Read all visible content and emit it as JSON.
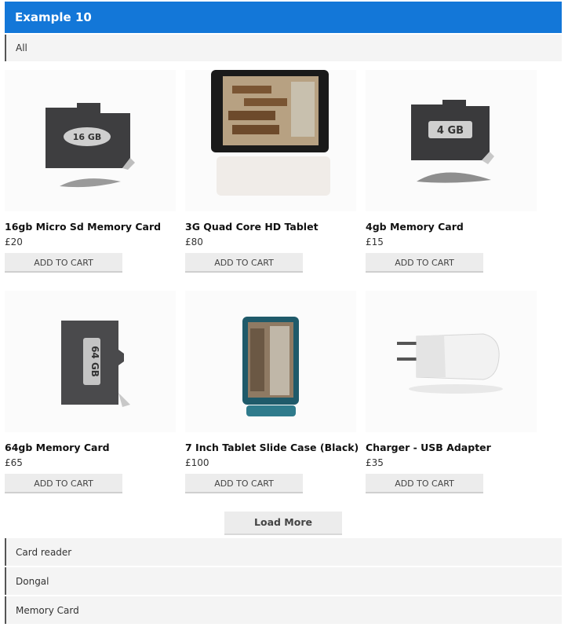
{
  "header": {
    "title": "Example 10"
  },
  "filter": {
    "label": "All"
  },
  "products": [
    {
      "name": "16gb Micro Sd Memory Card",
      "price": "£20",
      "button": "ADD TO CART",
      "card_text": "16 GB"
    },
    {
      "name": "3G Quad Core HD Tablet",
      "price": "£80",
      "button": "ADD TO CART"
    },
    {
      "name": "4gb Memory Card",
      "price": "£15",
      "button": "ADD TO CART",
      "card_text": "4 GB"
    },
    {
      "name": "64gb Memory Card",
      "price": "£65",
      "button": "ADD TO CART",
      "card_text": "64 GB"
    },
    {
      "name": "7 Inch Tablet Slide Case (Black)",
      "price": "£100",
      "button": "ADD TO CART"
    },
    {
      "name": "Charger - USB Adapter",
      "price": "£35",
      "button": "ADD TO CART"
    }
  ],
  "load_more": "Load More",
  "categories": [
    {
      "label": "Card reader"
    },
    {
      "label": "Dongal"
    },
    {
      "label": "Memory Card"
    }
  ],
  "colors": {
    "header_bg": "#1377d8",
    "accordion_bg": "#f4f4f4",
    "button_bg": "#ececec"
  }
}
